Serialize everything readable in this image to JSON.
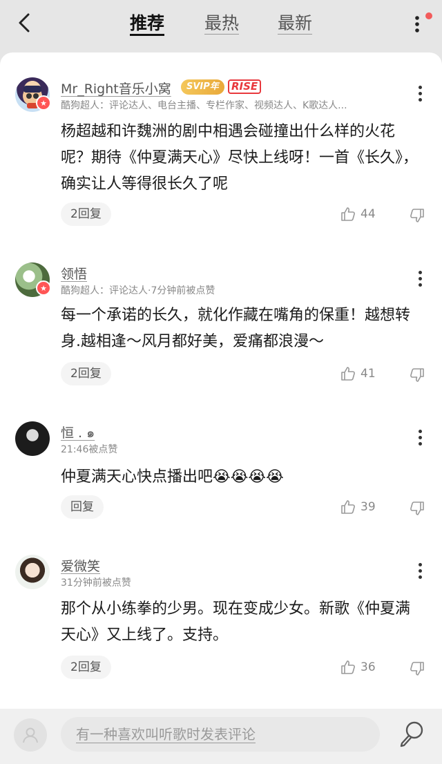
{
  "header": {
    "tabs": [
      {
        "label": "推荐",
        "active": true
      },
      {
        "label": "最热",
        "active": false
      },
      {
        "label": "最新",
        "active": false
      }
    ]
  },
  "comments": [
    {
      "name": "Mr_Right音乐小窝",
      "badge_svip": "SVIP年",
      "badge_rise": "RISE",
      "meta": "酷狗超人：评论达人、电台主播、专栏作家、视频达人、K歌达人...",
      "text": "杨超越和许魏洲的剧中相遇会碰撞出什么样的火花呢？期待《仲夏满天心》尽快上线呀！一首《长久》，确实让人等得很长久了呢",
      "reply": "2回复",
      "likes": "44"
    },
    {
      "name": "领悟",
      "meta": "酷狗超人：评论达人·7分钟前被点赞",
      "text": "每一个承诺的长久，就化作藏在嘴角的保重！越想转身.越相逢～风月都好美，爱痛都浪漫～",
      "reply": "2回复",
      "likes": "41"
    },
    {
      "name": "恒 .          ๑",
      "meta": "21:46被点赞",
      "text": "仲夏满天心快点播出吧😭😭😭😭",
      "reply": "回复",
      "likes": "39"
    },
    {
      "name": "爱微笑",
      "meta": "31分钟前被点赞",
      "text": "那个从小练拳的少男。现在变成少女。新歌《仲夏满天心》又上线了。支持。",
      "reply": "2回复",
      "likes": "36"
    }
  ],
  "footer": {
    "input_placeholder": "有一种喜欢叫听歌时发表评论"
  },
  "colors": {
    "accent_red": "#e8383d",
    "svip_gold": "#f4c75b"
  }
}
